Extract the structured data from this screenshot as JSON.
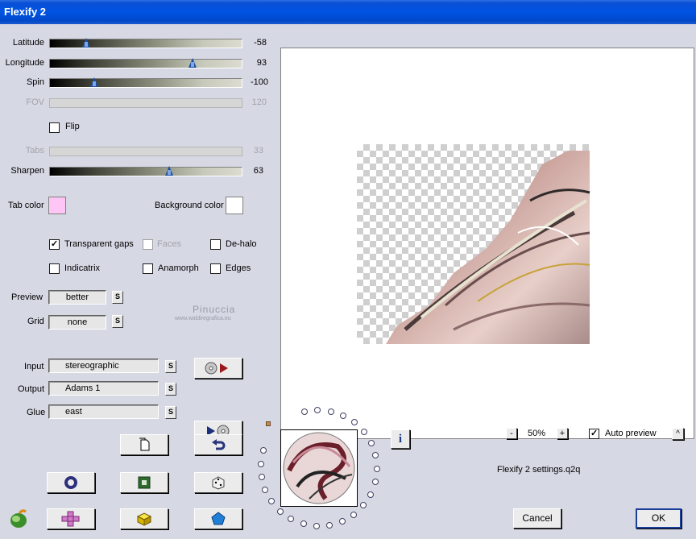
{
  "window": {
    "title": "Flexify 2"
  },
  "sliders": {
    "latitude": {
      "label": "Latitude",
      "value": "-58",
      "fraction": 0.19
    },
    "longitude": {
      "label": "Longitude",
      "value": "93",
      "fraction": 0.745
    },
    "spin": {
      "label": "Spin",
      "value": "-100",
      "fraction": 0.23
    },
    "fov": {
      "label": "FOV",
      "value": "120"
    },
    "tabs": {
      "label": "Tabs",
      "value": "33"
    },
    "sharpen": {
      "label": "Sharpen",
      "value": "63",
      "fraction": 0.62
    }
  },
  "flip": {
    "label": "Flip",
    "checked": false
  },
  "colors": {
    "tab_label": "Tab color",
    "tab_value": "#ffc6f5",
    "background_label": "Background color",
    "background_value": "#ffffff"
  },
  "options": {
    "transparent_gaps": {
      "label": "Transparent gaps",
      "checked": true
    },
    "faces": {
      "label": "Faces",
      "checked": false
    },
    "de_halo": {
      "label": "De-halo",
      "checked": false
    },
    "indicatrix": {
      "label": "Indicatrix",
      "checked": false
    },
    "anamorph": {
      "label": "Anamorph",
      "checked": false
    },
    "edges": {
      "label": "Edges",
      "checked": false
    }
  },
  "preview_select": {
    "label": "Preview",
    "value": "better",
    "s_label": "S"
  },
  "grid_select": {
    "label": "Grid",
    "value": "none",
    "s_label": "S"
  },
  "watermark": {
    "name": "Pinuccia",
    "url": "www.waldiregrafica.eu"
  },
  "projection": {
    "input_label": "Input",
    "input_value": "stereographic",
    "output_label": "Output",
    "output_value": "Adams 1",
    "glue_label": "Glue",
    "glue_value": "east",
    "s_label": "S"
  },
  "zoom": {
    "minus": "-",
    "value": "50%",
    "plus": "+"
  },
  "auto_preview": {
    "label": "Auto preview",
    "checked": true,
    "expand": "^"
  },
  "info_label": "i",
  "settings_file": "Flexify 2 settings.q2q",
  "buttons": {
    "cancel": "Cancel",
    "ok": "OK"
  },
  "accent_colors": {
    "title_bar": "#0054e3",
    "panel": "#d6d8e4",
    "ok_border": "#1d3f9a"
  }
}
